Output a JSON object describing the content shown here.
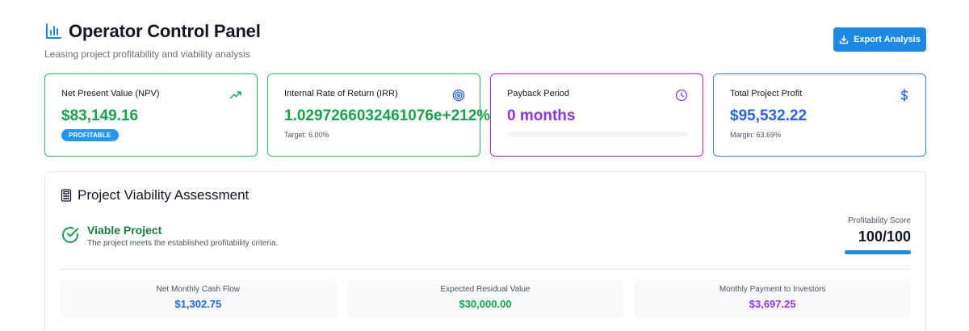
{
  "header": {
    "title": "Operator Control Panel",
    "subtitle": "Leasing project profitability and viability analysis",
    "export_label": "Export Analysis"
  },
  "cards": [
    {
      "label": "Net Present Value (NPV)",
      "value": "$83,149.16",
      "badge": "PROFITABLE",
      "icon": "trending-up-icon"
    },
    {
      "label": "Internal Rate of Return (IRR)",
      "value": "1.0297266032461076e+212%",
      "note": "Target: 6.00%",
      "icon": "target-icon"
    },
    {
      "label": "Payback Period",
      "value": "0 months",
      "progress": 0,
      "icon": "clock-icon"
    },
    {
      "label": "Total Project Profit",
      "value": "$95,532.22",
      "note": "Margin: 63.69%",
      "icon": "dollar-icon"
    }
  ],
  "viability": {
    "title": "Project Viability Assessment",
    "status_title": "Viable Project",
    "status_desc": "The project meets the established profitability criteria.",
    "score_label": "Profitability Score",
    "score_value": "100/100",
    "score_fraction": 1.0
  },
  "metrics": [
    {
      "label": "Net Monthly Cash Flow",
      "value": "$1,302.75",
      "color": "#2563eb"
    },
    {
      "label": "Expected Residual Value",
      "value": "$30,000.00",
      "color": "#16a34a"
    },
    {
      "label": "Monthly Payment to Investors",
      "value": "$3,697.25",
      "color": "#9333ea"
    }
  ],
  "colors": {
    "accent": "#1e88e5",
    "green": "#16a34a",
    "purple": "#9333ea",
    "blue": "#2563eb"
  }
}
